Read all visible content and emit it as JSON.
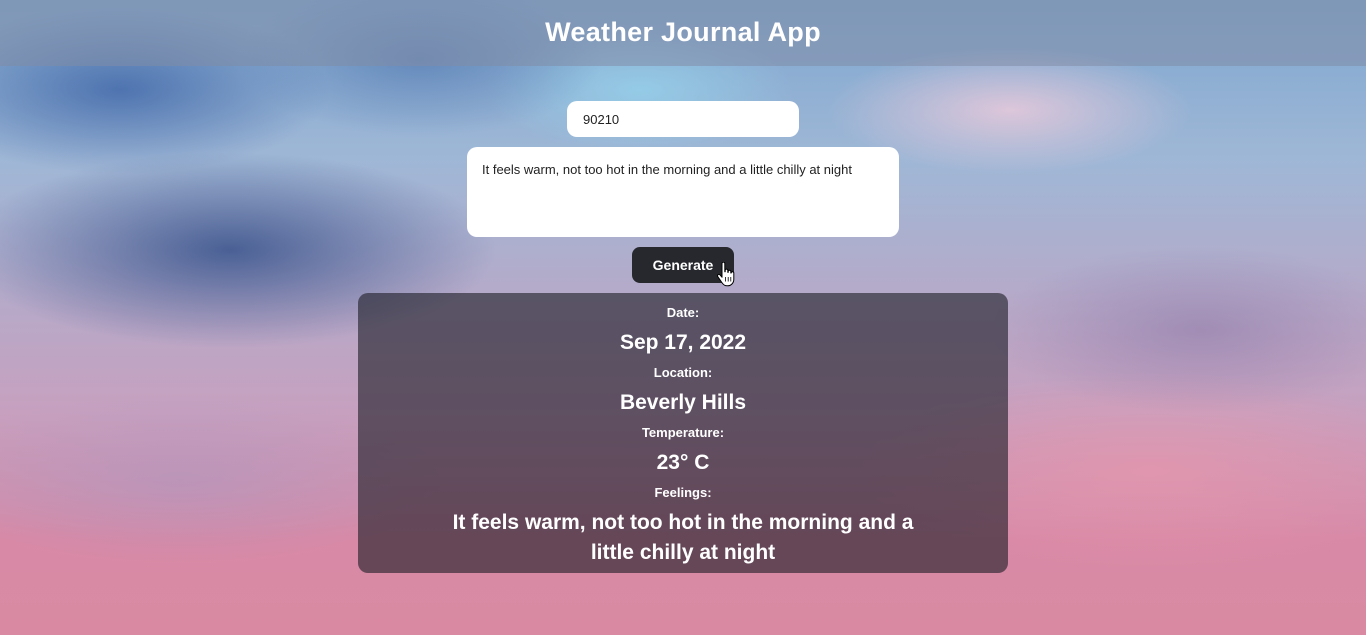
{
  "app": {
    "title": "Weather Journal App"
  },
  "form": {
    "zip_value": "90210",
    "feelings_value": "It feels warm, not too hot in the morning and a little chilly at night",
    "generate_label": "Generate"
  },
  "entry": {
    "date_label": "Date:",
    "date_value": "Sep 17, 2022",
    "location_label": "Location:",
    "location_value": "Beverly Hills",
    "temperature_label": "Temperature:",
    "temperature_value": "23° C",
    "feelings_label": "Feelings:",
    "feelings_value": "It feels warm, not too hot in the morning and a little chilly at night"
  },
  "icons": {
    "cursor": "hand-pointer-icon"
  },
  "colors": {
    "button_bg": "#26282d",
    "panel_bg": "rgba(30,30,40,0.62)",
    "text": "#ffffff"
  }
}
